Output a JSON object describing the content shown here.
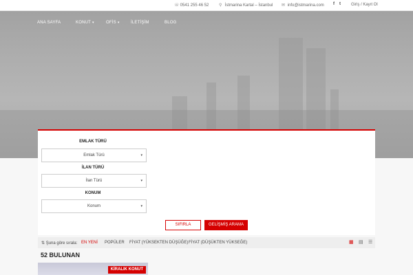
{
  "topbar": {
    "phone": "0541 255 46 52",
    "address": "İstmarina Kartal – İstanbul",
    "email": "info@istmarina.com",
    "social": [
      "f",
      "t"
    ],
    "auth": "Giriş / Kayıt Ol"
  },
  "nav": {
    "items": [
      {
        "label": "ANA SAYFA",
        "dropdown": false
      },
      {
        "label": "KONUT",
        "dropdown": true
      },
      {
        "label": "OFİS",
        "dropdown": true
      },
      {
        "label": "İLETİŞİM",
        "dropdown": false
      },
      {
        "label": "BLOG",
        "dropdown": false
      }
    ]
  },
  "search": {
    "fields": [
      {
        "label": "EMLAK TÜRÜ",
        "value": "Emlak Türü"
      },
      {
        "label": "İLAN TÜRÜ",
        "value": "İlan Türü"
      },
      {
        "label": "KONUM",
        "value": "Konum"
      }
    ],
    "reset_label": "SIFIRLA",
    "advanced_label": "GELİŞMİŞ ARAMA"
  },
  "sort": {
    "label": "Şuna göre sırala:",
    "options": [
      "EN YENİ",
      "POPÜLER",
      "FİYAT (YÜKSEKTEN DÜŞÜĞE)",
      "FİYAT (DÜŞÜKTEN YÜKSEĞE)"
    ],
    "active_option": "EN YENİ"
  },
  "results": {
    "count_text": "52 BULUNAN"
  },
  "cards": [
    {
      "badge": "KİRALIK KONUT"
    }
  ],
  "colors": {
    "accent": "#d50000",
    "hero_gray": "#a9a9a9"
  },
  "icons": {
    "phone": "phone-icon",
    "location": "map-pin-icon",
    "email": "envelope-icon",
    "grid_view": "grid-icon",
    "list_view": "list-icon"
  }
}
